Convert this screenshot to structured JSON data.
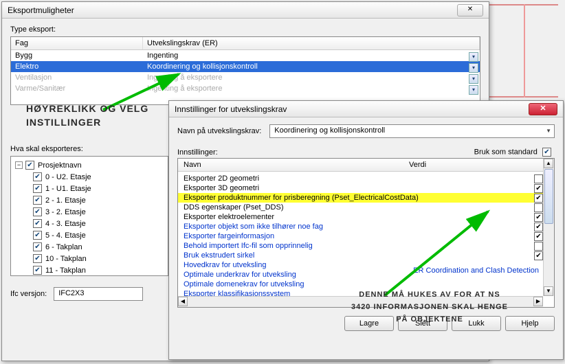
{
  "window1": {
    "title": "Eksportmuligheter",
    "type_label": "Type eksport:",
    "grid": {
      "headers": {
        "col1": "Fag",
        "col2": "Utvekslingskrav (ER)"
      },
      "rows": [
        {
          "fag": "Bygg",
          "er": "Ingenting",
          "state": "normal"
        },
        {
          "fag": "Elektro",
          "er": "Koordinering og kollisjonskontroll",
          "state": "selected"
        },
        {
          "fag": "Ventilasjon",
          "er": "Ingenting å eksportere",
          "state": "disabled"
        },
        {
          "fag": "Varme/Sanitær",
          "er": "Ingenting å eksportere",
          "state": "disabled"
        }
      ]
    },
    "export_label": "Hva skal eksporteres:",
    "tree": {
      "root": "Prosjektnavn",
      "children": [
        "0 - U2. Etasje",
        "1 - U1. Etasje",
        "2 - 1. Etasje",
        "3 - 2. Etasje",
        "4 - 3. Etasje",
        "5 - 4. Etasje",
        "6 - Takplan",
        "10 - Takplan",
        "11 - Takplan"
      ]
    },
    "version_label": "Ifc versjon:",
    "version_value": "IFC2X3"
  },
  "window2": {
    "title": "Innstillinger for utvekslingskrav",
    "name_label": "Navn på utvekslingskrav:",
    "name_value": "Koordinering og kollisjonskontroll",
    "settings_label": "Innstillinger:",
    "std_label": "Bruk som standard",
    "std_checked": true,
    "headers": {
      "name": "Navn",
      "value": "Verdi"
    },
    "rows": [
      {
        "name": "Eksporter 2D geometri",
        "link": false,
        "checked": false
      },
      {
        "name": "Eksporter 3D geometri",
        "link": false,
        "checked": true
      },
      {
        "name": "Eksporter produktnummer for prisberegning (Pset_ElectricalCostData)",
        "link": false,
        "checked": true,
        "highlight": true
      },
      {
        "name": "DDS egenskaper (Pset_DDS)",
        "link": false,
        "checked": false
      },
      {
        "name": "Eksporter elektroelementer",
        "link": false,
        "checked": true
      },
      {
        "name": "Eksporter objekt som ikke tilhører noe fag",
        "link": true,
        "checked": true
      },
      {
        "name": "Eksporter fargeinformasjon",
        "link": true,
        "checked": true
      },
      {
        "name": "Behold importert Ifc-fil som opprinnelig",
        "link": true,
        "checked": false
      },
      {
        "name": "Bruk ekstrudert sirkel",
        "link": true,
        "checked": true
      },
      {
        "name": "Hovedkrav for utveksling",
        "link": true,
        "checked": null
      },
      {
        "name": "Optimale underkrav for utveksling",
        "link": true,
        "checked": null
      },
      {
        "name": "Optimale domenekrav for utveksling",
        "link": true,
        "checked": null
      },
      {
        "name": "Eksporter klassifikasjonssystem",
        "link": true,
        "checked": null
      }
    ],
    "er_link": "ER Coordination and Clash Detection",
    "buttons": {
      "save": "Lagre",
      "delete": "Slett",
      "close": "Lukk",
      "help": "Hjelp"
    }
  },
  "annotations": {
    "a1": "Høyreklikk og velg instillinger",
    "a2_l1": "Denne må hukes av for at NS",
    "a2_l2": "3420 informasjonen skal henge",
    "a2_l3": "på objektene"
  }
}
